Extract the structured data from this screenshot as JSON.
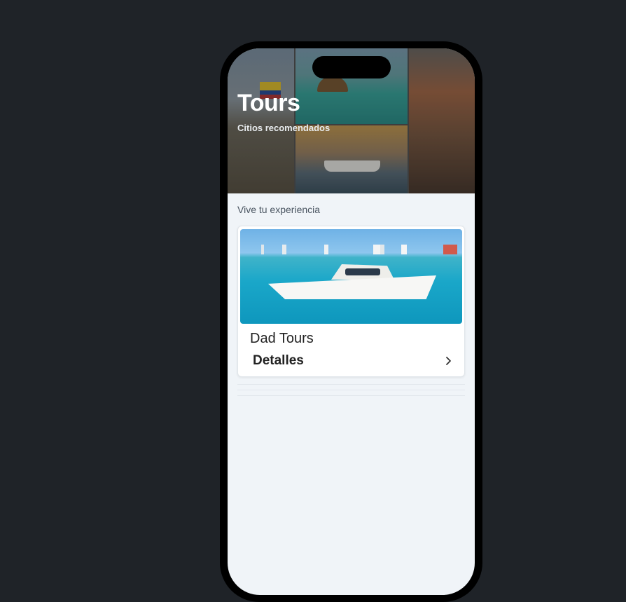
{
  "hero": {
    "title": "Tours",
    "subtitle": "Citios recomendados"
  },
  "section": {
    "label": "Vive tu experiencia"
  },
  "card": {
    "title": "Dad Tours",
    "details_label": "Detalles",
    "details_icon": "chevron-right-icon"
  },
  "colors": {
    "page_background": "#1f2328",
    "screen_background": "#f0f4f8",
    "text_dark": "#222222",
    "text_muted": "#4a5561"
  }
}
